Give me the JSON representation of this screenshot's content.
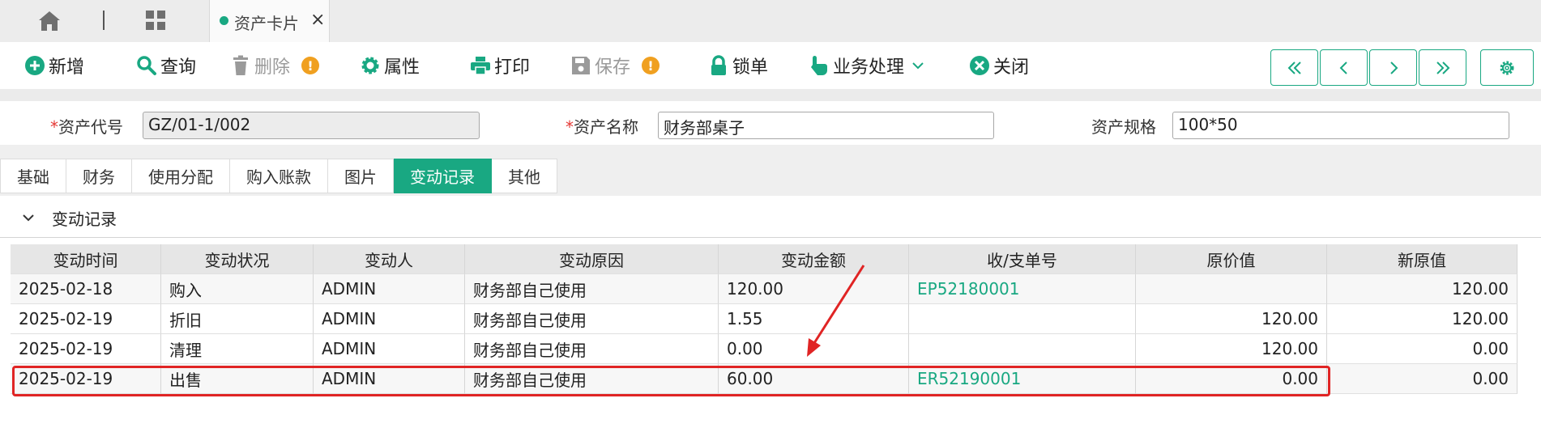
{
  "doc_tab": {
    "title": "资产卡片",
    "close": "×"
  },
  "toolbar": {
    "add": "新增",
    "query": "查询",
    "delete": "删除",
    "props": "属性",
    "print": "打印",
    "save": "保存",
    "lock": "锁单",
    "business": "业务处理",
    "close": "关闭",
    "warn": "!"
  },
  "form": {
    "code_label": "资产代号",
    "code_value": "GZ/01-1/002",
    "name_label": "资产名称",
    "name_value": "财务部桌子",
    "spec_label": "资产规格",
    "spec_value": "100*50",
    "required": "*"
  },
  "tabs": [
    "基础",
    "财务",
    "使用分配",
    "购入账款",
    "图片",
    "变动记录",
    "其他"
  ],
  "section": {
    "title": "变动记录"
  },
  "table": {
    "headers": [
      "变动时间",
      "变动状况",
      "变动人",
      "变动原因",
      "变动金额",
      "收/支单号",
      "原价值",
      "新原值"
    ],
    "rows": [
      [
        "2025-02-18",
        "购入",
        "ADMIN",
        "财务部自己使用",
        "120.00",
        "EP52180001",
        "",
        "120.00"
      ],
      [
        "2025-02-19",
        "折旧",
        "ADMIN",
        "财务部自己使用",
        "1.55",
        "",
        "120.00",
        "120.00"
      ],
      [
        "2025-02-19",
        "清理",
        "ADMIN",
        "财务部自己使用",
        "0.00",
        "",
        "120.00",
        "0.00"
      ],
      [
        "2025-02-19",
        "出售",
        "ADMIN",
        "财务部自己使用",
        "60.00",
        "ER52190001",
        "0.00",
        "0.00"
      ]
    ]
  },
  "colors": {
    "accent": "#19a882",
    "highlight": "#e02424",
    "warning": "#f0a020"
  }
}
